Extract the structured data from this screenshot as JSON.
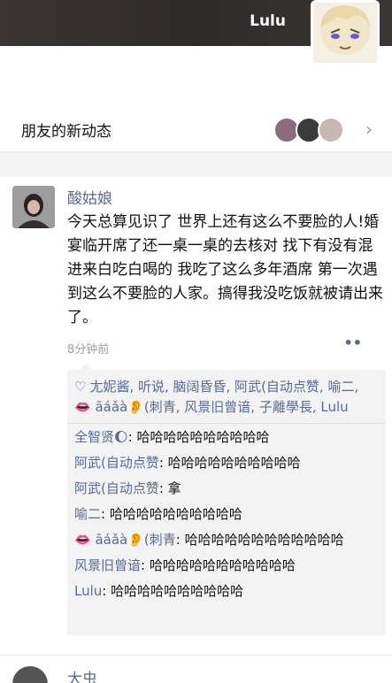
{
  "profile": {
    "name": "Lulu"
  },
  "feed_entry": {
    "label": "朋友的新动态",
    "chevron": "›",
    "avatars": [
      "#8a6c7c",
      "#3b3b3b",
      "#c9b8b0"
    ]
  },
  "post": {
    "author": "酸姑娘",
    "text": "今天总算见识了 世界上还有这么不要脸的人!婚宴临开席了还一桌一桌的去核对 找下有没有混进来白吃白喝的 我吃了这么多年酒席 第一次遇到这么不要脸的人家。搞得我没吃饭就被请出来了。",
    "time": "8分钟前",
    "more": "••",
    "likes": "尢妮酱, 听说, 脑阔昏昏, 阿武(自动点赞, 喻二, 👄 āáǎà👂(刺青, 风景旧曾谙, 子離學長, Lulu",
    "heart": "♡",
    "comments": [
      {
        "author": "全智贤🌔",
        "text": ": 哈哈哈哈哈哈哈哈哈哈"
      },
      {
        "author": "阿武(自动点赞",
        "text": ": 哈哈哈哈哈哈哈哈哈哈"
      },
      {
        "author": "阿武(自动点赞",
        "text": ": 拿"
      },
      {
        "author": "喻二",
        "text": ": 哈哈哈哈哈哈哈哈哈哈"
      },
      {
        "author": "👄 āáǎà👂(刺青",
        "text": ": 哈哈哈哈哈哈哈哈哈哈哈哈"
      },
      {
        "author": "风景旧曾谙",
        "text": ": 哈哈哈哈哈哈哈哈哈哈哈"
      },
      {
        "author": "Lulu",
        "text": ": 哈哈哈哈哈哈哈哈哈哈"
      }
    ]
  },
  "next_post": {
    "author": "大虫"
  },
  "colors": {
    "link": "#576b95",
    "comment_bg": "#f3f3f3",
    "cover": "#2f2a2a"
  }
}
